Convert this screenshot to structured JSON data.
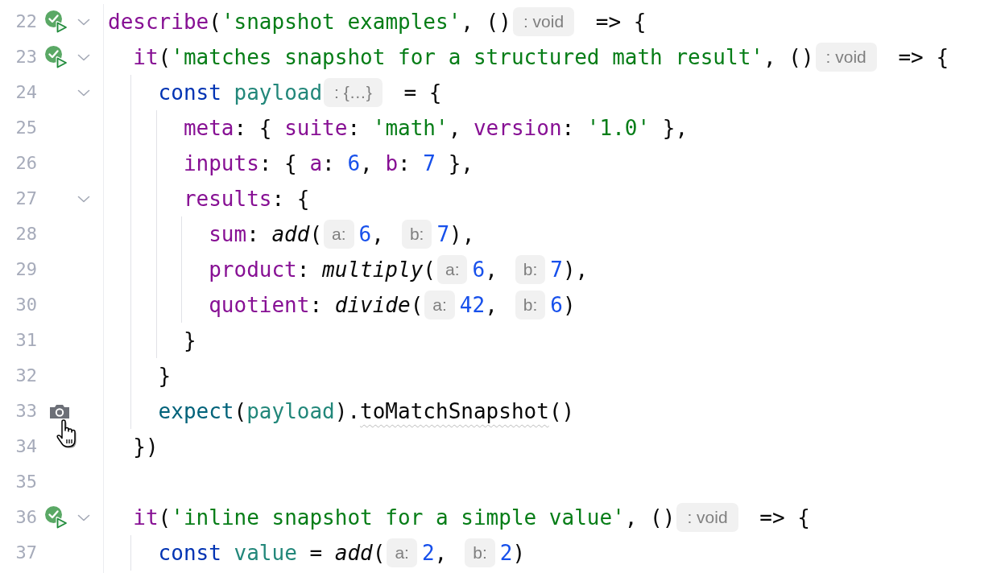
{
  "editor": {
    "lines": [
      {
        "number": "22",
        "gutter": {
          "kind": "run-passed",
          "hovered": false
        },
        "expanded": true,
        "tokens": [
          {
            "kind": "call",
            "text": "describe"
          },
          {
            "kind": "plain",
            "text": "("
          },
          {
            "kind": "string",
            "text": "'snapshot examples'"
          },
          {
            "kind": "plain",
            "text": ", ()"
          },
          {
            "kind": "hint",
            "text": ": void"
          },
          {
            "kind": "plain",
            "text": " => {"
          }
        ],
        "children": [
          {
            "number": "23",
            "gutter": {
              "kind": "run-passed",
              "hovered": false
            },
            "expanded": true,
            "tokens": [
              {
                "kind": "call",
                "text": "it"
              },
              {
                "kind": "plain",
                "text": "("
              },
              {
                "kind": "string",
                "text": "'matches snapshot for a structured math result'"
              },
              {
                "kind": "plain",
                "text": ", ()"
              },
              {
                "kind": "hint",
                "text": ": void"
              },
              {
                "kind": "plain",
                "text": " => {"
              }
            ],
            "children": [
              {
                "number": "24",
                "expanded": true,
                "tokens": [
                  {
                    "kind": "keyword",
                    "text": "const"
                  },
                  {
                    "kind": "variable",
                    "text": " payload"
                  },
                  {
                    "kind": "hint",
                    "text": ": {…}"
                  },
                  {
                    "kind": "plain",
                    "text": " = {"
                  }
                ],
                "children": [
                  {
                    "number": "25",
                    "tokens": [
                      {
                        "kind": "property",
                        "text": "meta"
                      },
                      {
                        "kind": "plain",
                        "text": ": { "
                      },
                      {
                        "kind": "property",
                        "text": "suite"
                      },
                      {
                        "kind": "plain",
                        "text": ": "
                      },
                      {
                        "kind": "string",
                        "text": "'math'"
                      },
                      {
                        "kind": "plain",
                        "text": ", "
                      },
                      {
                        "kind": "property",
                        "text": "version"
                      },
                      {
                        "kind": "plain",
                        "text": ": "
                      },
                      {
                        "kind": "string",
                        "text": "'1.0'"
                      },
                      {
                        "kind": "plain",
                        "text": " },"
                      }
                    ]
                  },
                  {
                    "number": "26",
                    "tokens": [
                      {
                        "kind": "property",
                        "text": "inputs"
                      },
                      {
                        "kind": "plain",
                        "text": ": { "
                      },
                      {
                        "kind": "property",
                        "text": "a"
                      },
                      {
                        "kind": "plain",
                        "text": ": "
                      },
                      {
                        "kind": "number",
                        "text": "6"
                      },
                      {
                        "kind": "plain",
                        "text": ", "
                      },
                      {
                        "kind": "property",
                        "text": "b"
                      },
                      {
                        "kind": "plain",
                        "text": ": "
                      },
                      {
                        "kind": "number",
                        "text": "7"
                      },
                      {
                        "kind": "plain",
                        "text": " },"
                      }
                    ]
                  },
                  {
                    "number": "27",
                    "expanded": true,
                    "tokens": [
                      {
                        "kind": "property",
                        "text": "results"
                      },
                      {
                        "kind": "plain",
                        "text": ": {"
                      }
                    ],
                    "children": [
                      {
                        "number": "28",
                        "tokens": [
                          {
                            "kind": "property",
                            "text": "sum"
                          },
                          {
                            "kind": "plain",
                            "text": ": "
                          },
                          {
                            "kind": "imported",
                            "text": "add"
                          },
                          {
                            "kind": "plain",
                            "text": "("
                          },
                          {
                            "kind": "hint",
                            "text": "a:"
                          },
                          {
                            "kind": "number",
                            "text": "6"
                          },
                          {
                            "kind": "plain",
                            "text": ","
                          },
                          {
                            "kind": "hint",
                            "text": "b:"
                          },
                          {
                            "kind": "number",
                            "text": "7"
                          },
                          {
                            "kind": "plain",
                            "text": "),"
                          }
                        ]
                      },
                      {
                        "number": "29",
                        "tokens": [
                          {
                            "kind": "property",
                            "text": "product"
                          },
                          {
                            "kind": "plain",
                            "text": ": "
                          },
                          {
                            "kind": "imported",
                            "text": "multiply"
                          },
                          {
                            "kind": "plain",
                            "text": "("
                          },
                          {
                            "kind": "hint",
                            "text": "a:"
                          },
                          {
                            "kind": "number",
                            "text": "6"
                          },
                          {
                            "kind": "plain",
                            "text": ","
                          },
                          {
                            "kind": "hint",
                            "text": "b:"
                          },
                          {
                            "kind": "number",
                            "text": "7"
                          },
                          {
                            "kind": "plain",
                            "text": "),"
                          }
                        ]
                      },
                      {
                        "number": "30",
                        "tokens": [
                          {
                            "kind": "property",
                            "text": "quotient"
                          },
                          {
                            "kind": "plain",
                            "text": ": "
                          },
                          {
                            "kind": "imported",
                            "text": "divide"
                          },
                          {
                            "kind": "plain",
                            "text": "("
                          },
                          {
                            "kind": "hint",
                            "text": "a:"
                          },
                          {
                            "kind": "number",
                            "text": "42"
                          },
                          {
                            "kind": "plain",
                            "text": ","
                          },
                          {
                            "kind": "hint",
                            "text": "b:"
                          },
                          {
                            "kind": "number",
                            "text": "6"
                          },
                          {
                            "kind": "plain",
                            "text": ")"
                          }
                        ]
                      }
                    ]
                  },
                  {
                    "number": "31",
                    "tokens": [
                      {
                        "kind": "plain",
                        "text": "}"
                      }
                    ]
                  }
                ]
              },
              {
                "number": "32",
                "tokens": [
                  {
                    "kind": "plain",
                    "text": "}"
                  }
                ]
              },
              {
                "number": "33",
                "gutter": {
                  "kind": "snapshot",
                  "hovered": true
                },
                "tokens": [
                  {
                    "kind": "function",
                    "text": "expect"
                  },
                  {
                    "kind": "plain",
                    "text": "("
                  },
                  {
                    "kind": "variable",
                    "text": "payload"
                  },
                  {
                    "kind": "plain",
                    "text": ")."
                  },
                  {
                    "kind": "warning",
                    "text": "toMatchSnapshot"
                  },
                  {
                    "kind": "plain",
                    "text": "()"
                  }
                ]
              }
            ]
          },
          {
            "number": "34",
            "tokens": [
              {
                "kind": "plain",
                "text": "})"
              }
            ]
          },
          {
            "number": "35"
          },
          {
            "number": "36",
            "gutter": {
              "kind": "run-passed",
              "hovered": false
            },
            "expanded": true,
            "tokens": [
              {
                "kind": "call",
                "text": "it"
              },
              {
                "kind": "plain",
                "text": "("
              },
              {
                "kind": "string",
                "text": "'inline snapshot for a simple value'"
              },
              {
                "kind": "plain",
                "text": ", ()"
              },
              {
                "kind": "hint",
                "text": ": void"
              },
              {
                "kind": "plain",
                "text": " => {"
              }
            ],
            "children": [
              {
                "number": "37",
                "tokens": [
                  {
                    "kind": "keyword",
                    "text": "const"
                  },
                  {
                    "kind": "variable",
                    "text": " value"
                  },
                  {
                    "kind": "plain",
                    "text": " = "
                  },
                  {
                    "kind": "imported",
                    "text": "add"
                  },
                  {
                    "kind": "plain",
                    "text": "("
                  },
                  {
                    "kind": "hint",
                    "text": "a:"
                  },
                  {
                    "kind": "number",
                    "text": "2"
                  },
                  {
                    "kind": "plain",
                    "text": ","
                  },
                  {
                    "kind": "hint",
                    "text": "b:"
                  },
                  {
                    "kind": "number",
                    "text": "2"
                  },
                  {
                    "kind": "plain",
                    "text": ")"
                  }
                ]
              }
            ]
          }
        ]
      }
    ]
  }
}
